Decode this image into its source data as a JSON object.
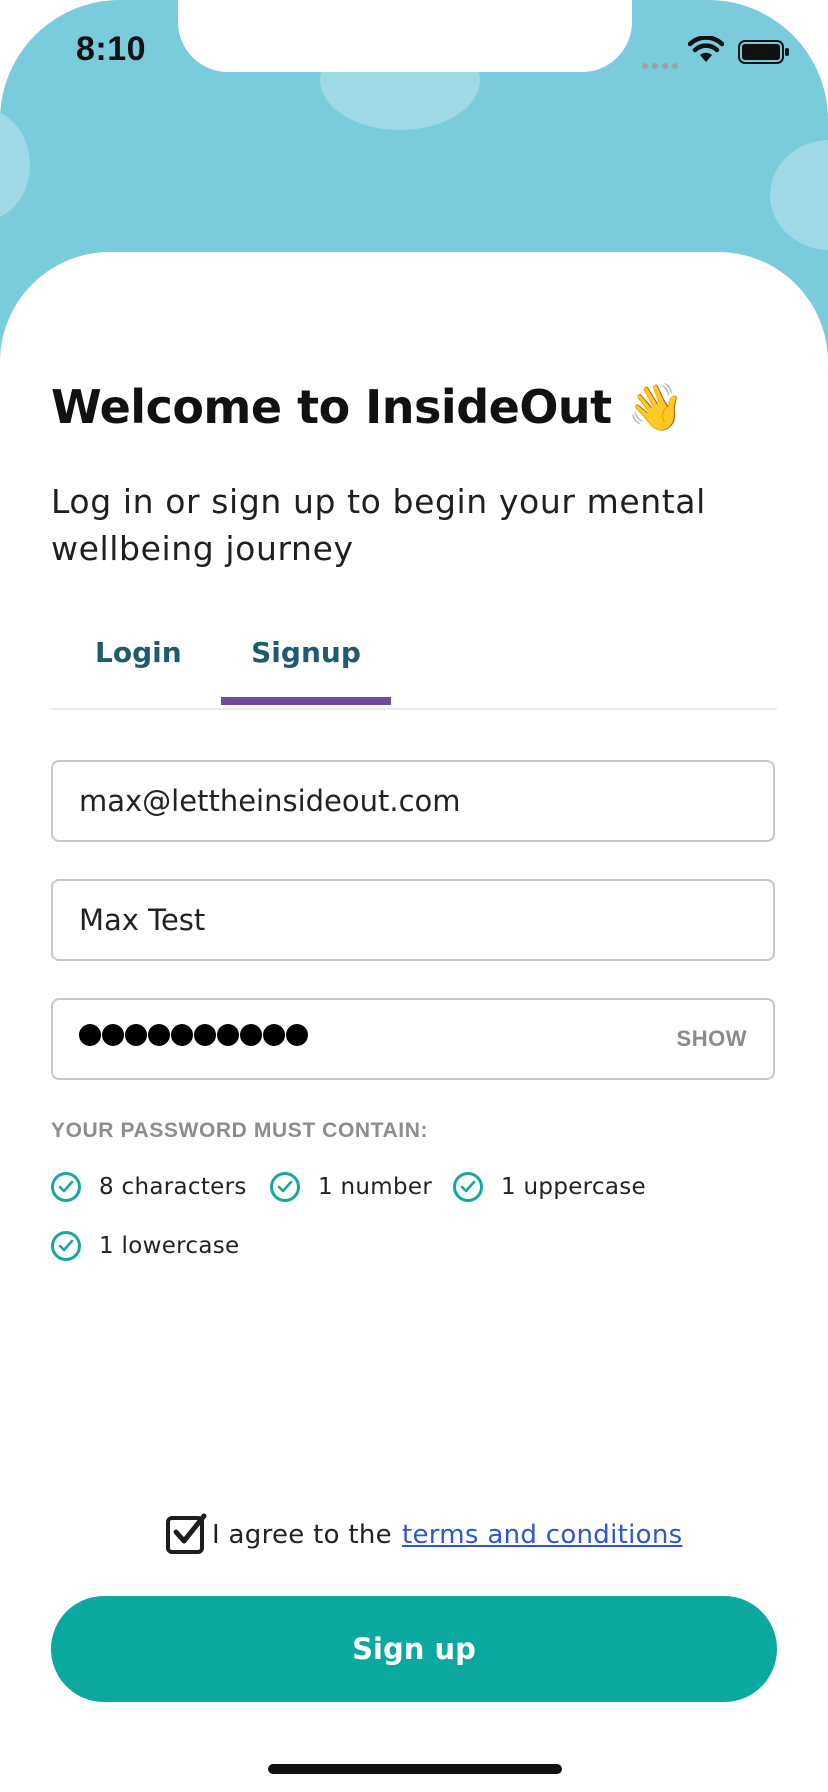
{
  "status_bar": {
    "time": "8:10"
  },
  "welcome": {
    "title": "Welcome to InsideOut",
    "emoji": "👋",
    "subtitle": "Log in or sign up to begin your mental wellbeing journey"
  },
  "tabs": {
    "login": "Login",
    "signup": "Signup",
    "active": "signup"
  },
  "form": {
    "email_value": "max@lettheinsideout.com",
    "name_value": "Max Test",
    "password_masked_length": 10,
    "show_label": "SHOW"
  },
  "requirements": {
    "heading": "YOUR PASSWORD MUST CONTAIN:",
    "items": [
      "8 characters",
      "1 number",
      "1 uppercase",
      "1 lowercase"
    ]
  },
  "agreement": {
    "text": "I agree to the",
    "link": "terms and conditions",
    "checked": true
  },
  "button": {
    "label": "Sign up"
  },
  "colors": {
    "hero": "#7acbdc",
    "accent": "#0aa89e",
    "tab_indicator": "#6b4ba0",
    "tab_text": "#1f5a6e",
    "link": "#2e57c8"
  }
}
